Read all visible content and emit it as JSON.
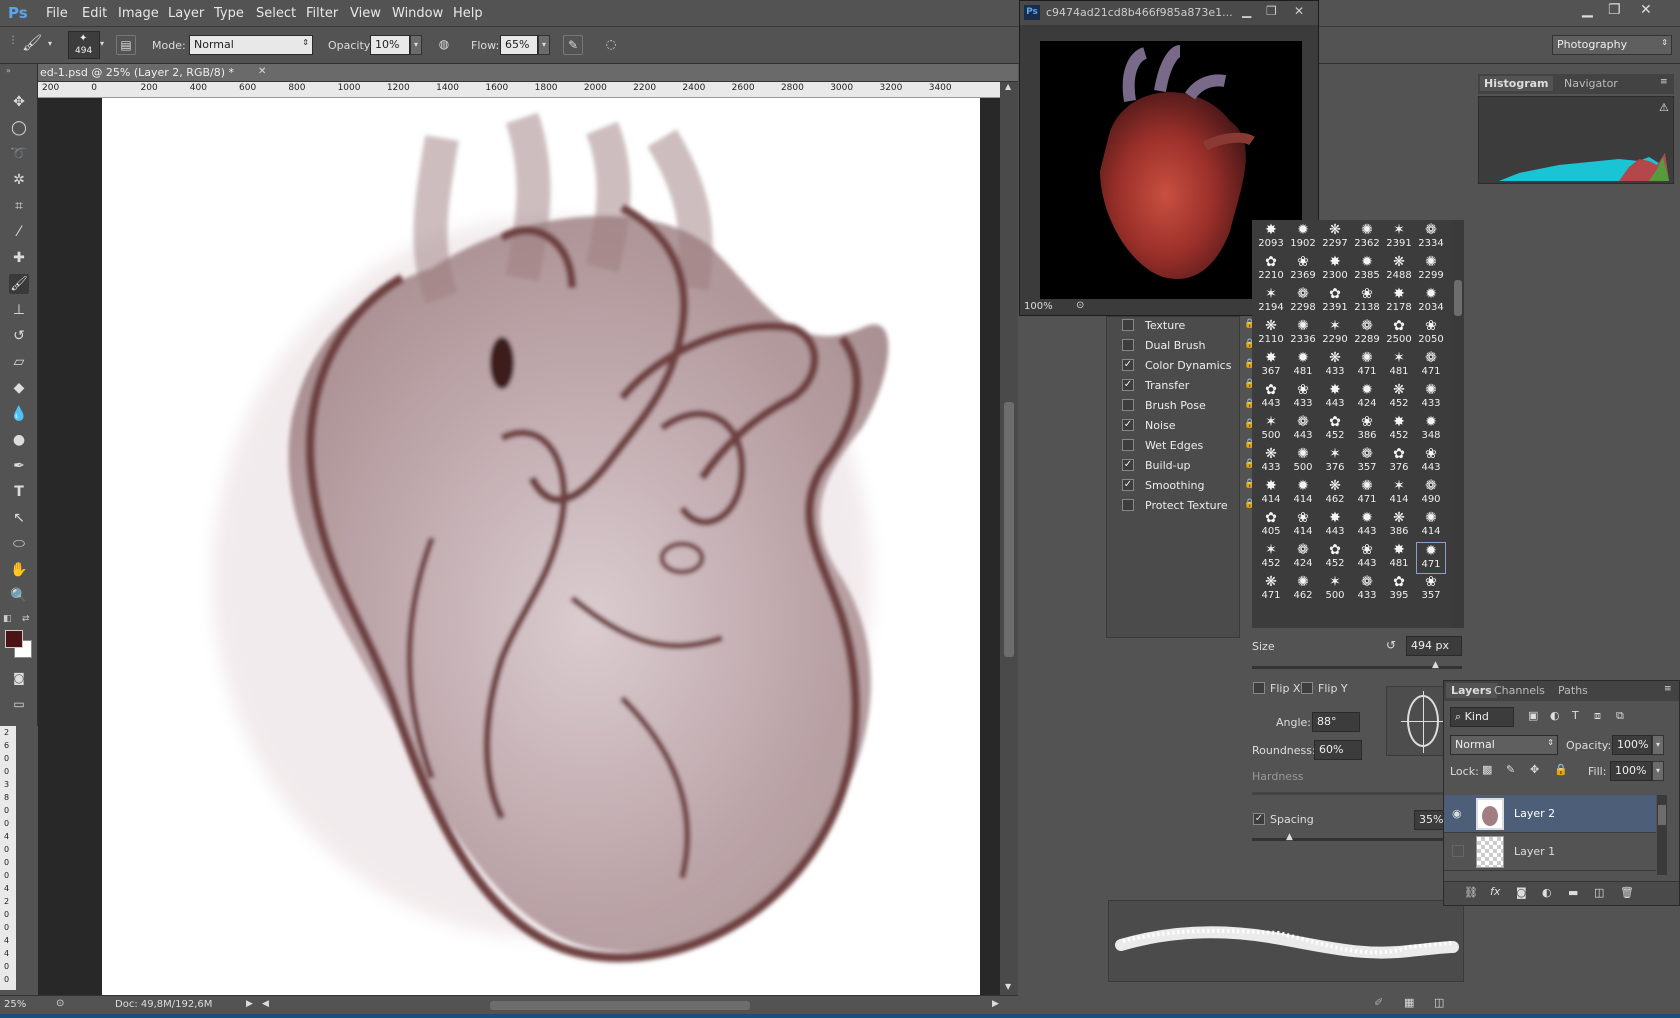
{
  "app": {
    "logo": "Ps",
    "menus": [
      "File",
      "Edit",
      "Image",
      "Layer",
      "Type",
      "Select",
      "Filter",
      "View",
      "Window",
      "Help"
    ]
  },
  "options": {
    "brush_size": "494",
    "mode_label": "Mode:",
    "mode_value": "Normal",
    "opacity_label": "Opacity:",
    "opacity_value": "10%",
    "flow_label": "Flow:",
    "flow_value": "65%",
    "workspace": "Photography"
  },
  "document": {
    "tab_title": "ed-1.psd @ 25% (Layer 2, RGB/8) *",
    "zoom": "25%",
    "doc_info": "Doc: 49,8M/192,6M",
    "ruler_ticks": [
      "200",
      "0",
      "200",
      "400",
      "600",
      "800",
      "1000",
      "1200",
      "1400",
      "1600",
      "1800",
      "2000",
      "2200",
      "2400",
      "2600",
      "2800",
      "3000",
      "3200",
      "3400"
    ],
    "left_ruler_ticks": [
      "2",
      "6",
      "0",
      "0",
      "3",
      "8",
      "0",
      "0",
      "4",
      "0",
      "0",
      "0",
      "4",
      "2",
      "0",
      "0",
      "4",
      "4",
      "0",
      "0"
    ]
  },
  "reference": {
    "title": "c9474ad21cd8b466f985a873e1...",
    "zoom": "100%"
  },
  "brush_options": [
    {
      "label": "Texture",
      "checked": false
    },
    {
      "label": "Dual Brush",
      "checked": false
    },
    {
      "label": "Color Dynamics",
      "checked": true
    },
    {
      "label": "Transfer",
      "checked": true
    },
    {
      "label": "Brush Pose",
      "checked": false
    },
    {
      "label": "Noise",
      "checked": true
    },
    {
      "label": "Wet Edges",
      "checked": false
    },
    {
      "label": "Build-up",
      "checked": true
    },
    {
      "label": "Smoothing",
      "checked": true
    },
    {
      "label": "Protect Texture",
      "checked": false
    }
  ],
  "brush_tips": [
    "2093",
    "1902",
    "2297",
    "2362",
    "2391",
    "2334",
    "2210",
    "2369",
    "2300",
    "2385",
    "2488",
    "2299",
    "2194",
    "2298",
    "2391",
    "2138",
    "2178",
    "2034",
    "2110",
    "2336",
    "2290",
    "2289",
    "2500",
    "2050",
    "367",
    "481",
    "433",
    "471",
    "481",
    "471",
    "443",
    "433",
    "443",
    "424",
    "452",
    "433",
    "500",
    "443",
    "452",
    "386",
    "452",
    "348",
    "433",
    "500",
    "376",
    "357",
    "376",
    "443",
    "414",
    "414",
    "462",
    "471",
    "414",
    "490",
    "405",
    "414",
    "443",
    "443",
    "386",
    "414",
    "452",
    "424",
    "452",
    "443",
    "481",
    "471",
    "471",
    "462",
    "500",
    "433",
    "395",
    "357"
  ],
  "brush_settings": {
    "size_label": "Size",
    "size_value": "494 px",
    "flip_x": "Flip X",
    "flip_y": "Flip Y",
    "angle_label": "Angle:",
    "angle_value": "88°",
    "roundness_label": "Roundness:",
    "roundness_value": "60%",
    "hardness_label": "Hardness",
    "spacing_label": "Spacing",
    "spacing_value": "35%"
  },
  "panels": {
    "histogram_tab": "Histogram",
    "navigator_tab": "Navigator"
  },
  "layers_panel": {
    "tabs": [
      "Layers",
      "Channels",
      "Paths"
    ],
    "kind_label": "Kind",
    "blend_mode": "Normal",
    "opacity_label": "Opacity:",
    "opacity_value": "100%",
    "lock_label": "Lock:",
    "fill_label": "Fill:",
    "fill_value": "100%",
    "layers": [
      {
        "name": "Layer 2",
        "selected": true,
        "visible": true
      },
      {
        "name": "Layer 1",
        "selected": false,
        "visible": false
      }
    ]
  },
  "colors": {
    "foreground": "#4a1414",
    "background": "#ffffff",
    "accent": "#4c5e78"
  }
}
